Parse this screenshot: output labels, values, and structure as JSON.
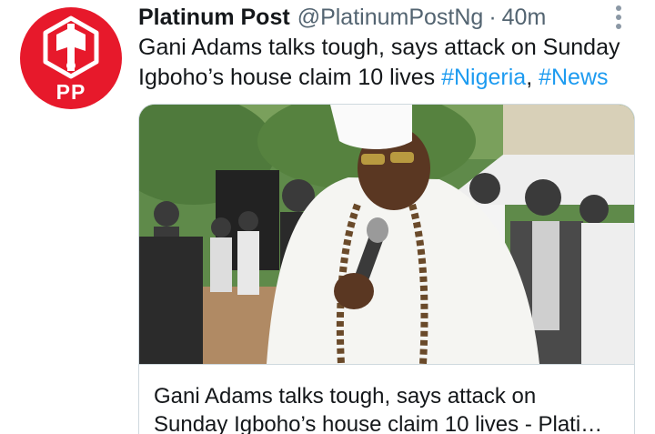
{
  "tweet": {
    "display_name": "Platinum Post",
    "handle": "@PlatinumPostNg",
    "separator": "·",
    "time": "40m",
    "text_line1": "Gani Adams talks tough, says attack on Sunday",
    "text_line2_prefix": "Igboho’s house claim 10 lives ",
    "hashtag1": "#Nigeria",
    "comma": ",",
    "hashtag2": "#News",
    "avatar_text": "PP",
    "menu_icon": "more-vertical-icon"
  },
  "card": {
    "title_line1": "Gani Adams talks tough, says attack on",
    "title_line2": "Sunday Igboho’s house claim 10 lives - Plati…"
  },
  "colors": {
    "brand_red": "#e7192b",
    "link_blue": "#1d9bf0",
    "text_dark": "#14171a",
    "text_gray": "#536471"
  }
}
